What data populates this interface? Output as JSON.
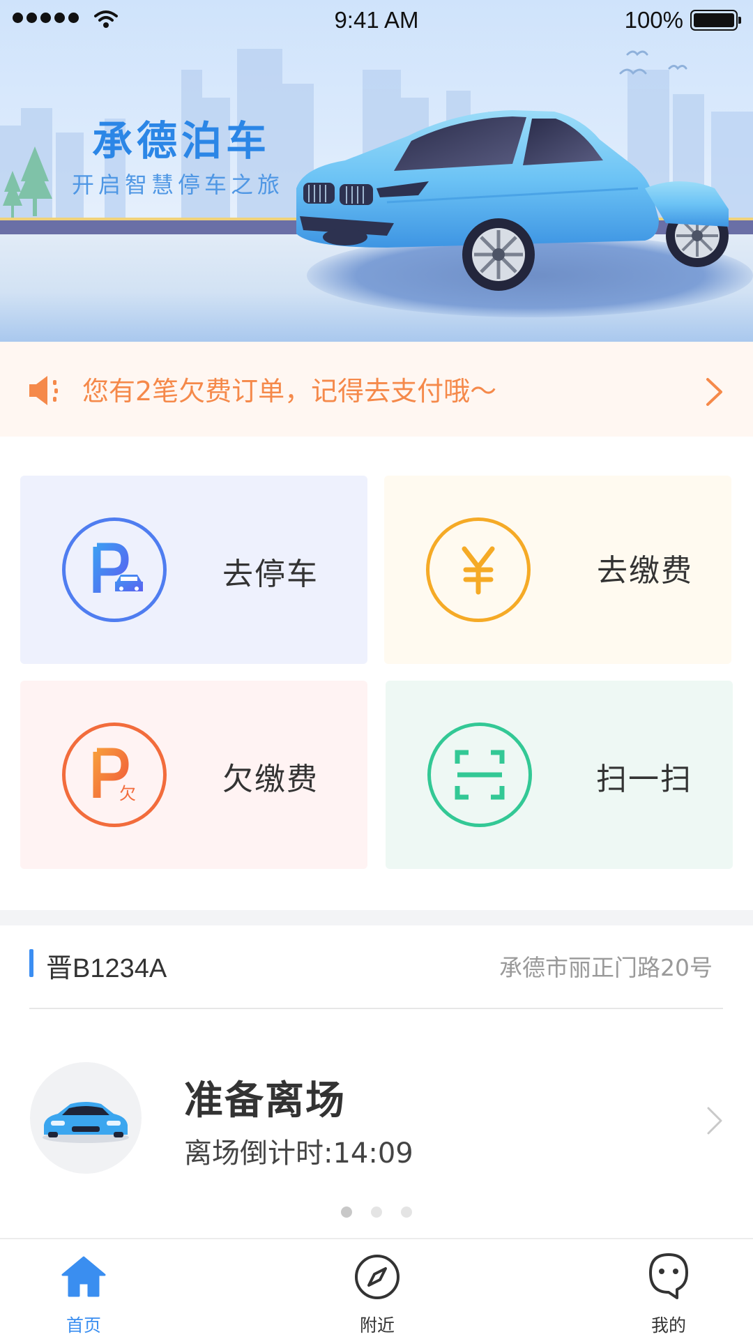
{
  "status_bar": {
    "time": "9:41 AM",
    "battery": "100%"
  },
  "banner": {
    "title": "承德泊车",
    "subtitle": "开启智慧停车之旅"
  },
  "notice": {
    "text": "您有2笔欠费订单，记得去支付哦～"
  },
  "actions": [
    {
      "label": "去停车",
      "icon": "parking-car-icon",
      "color": "#4f7df0"
    },
    {
      "label": "去缴费",
      "icon": "yuan-icon",
      "color": "#f5aa26"
    },
    {
      "label": "欠缴费",
      "icon": "parking-owe-icon",
      "color": "#f26c3c"
    },
    {
      "label": "扫一扫",
      "icon": "scan-icon",
      "color": "#33c895"
    }
  ],
  "order": {
    "plate": "晋B1234A",
    "address": "承德市丽正门路20号",
    "status": "准备离场",
    "countdown": "离场倒计时:14:09"
  },
  "carousel": {
    "count": 3,
    "active_index": 0
  },
  "tabbar": {
    "items": [
      {
        "label": "首页",
        "icon": "home-icon",
        "active": true
      },
      {
        "label": "附近",
        "icon": "compass-icon",
        "active": false
      },
      {
        "label": "我的",
        "icon": "profile-icon",
        "active": false
      }
    ],
    "active_color": "#3a8ef0"
  }
}
